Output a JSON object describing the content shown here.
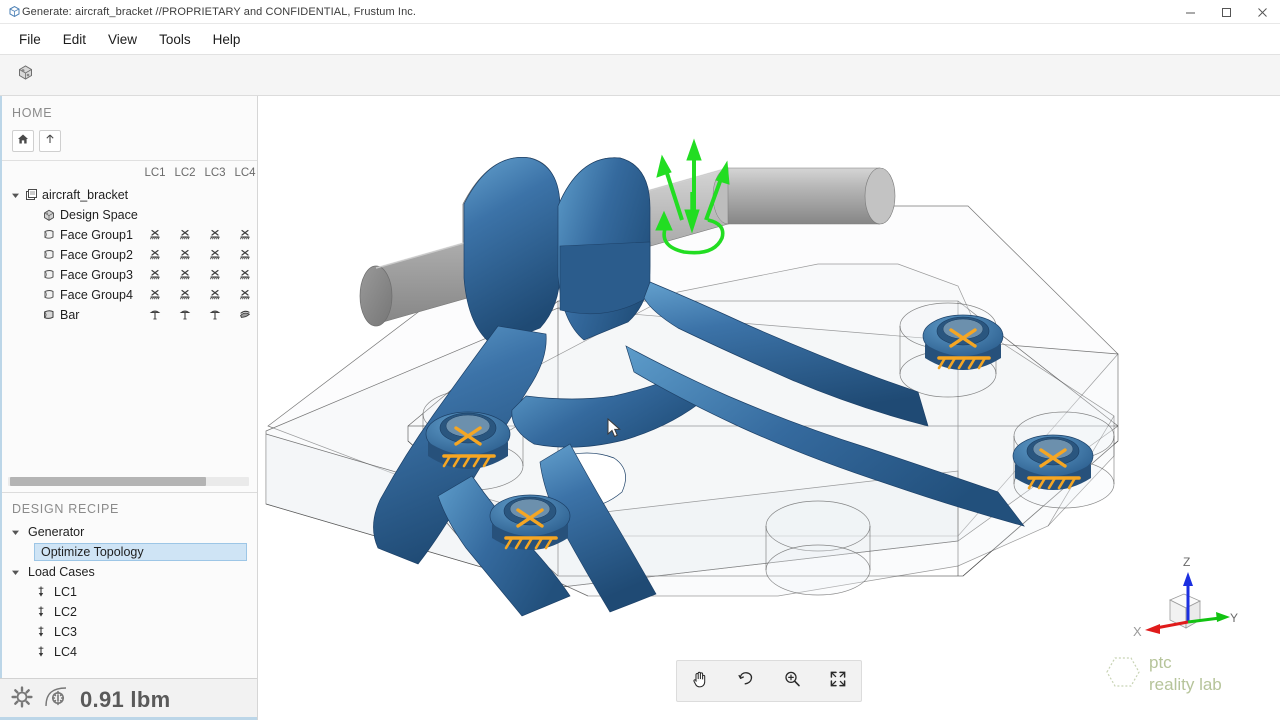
{
  "window": {
    "title": "Generate: aircraft_bracket //PROPRIETARY and CONFIDENTIAL, Frustum Inc.",
    "app_icon": "generate-app-icon",
    "minimize": "–",
    "maximize": "□",
    "close": "×"
  },
  "menubar": {
    "items": [
      {
        "label": "File"
      },
      {
        "label": "Edit"
      },
      {
        "label": "View"
      },
      {
        "label": "Tools"
      },
      {
        "label": "Help"
      }
    ]
  },
  "toolbar": {
    "items": [
      {
        "name": "part-model-icon",
        "tooltip": "Part"
      }
    ]
  },
  "browser": {
    "title": "HOME",
    "nav": [
      {
        "name": "home-button",
        "icon": "home-icon"
      },
      {
        "name": "up-level-button",
        "icon": "arrow-up-icon"
      }
    ],
    "load_case_columns": [
      "LC1",
      "LC2",
      "LC3",
      "LC4"
    ],
    "tree": [
      {
        "label": "aircraft_bracket",
        "icon": "assembly-icon",
        "indent": 0,
        "expander": "expanded",
        "markers": [
          "",
          "",
          "",
          ""
        ]
      },
      {
        "label": "Design Space",
        "icon": "design-space-icon",
        "indent": 1,
        "expander": "none",
        "markers": [
          "",
          "",
          "",
          ""
        ]
      },
      {
        "label": "Face Group1",
        "icon": "face-group-icon",
        "indent": 1,
        "expander": "none",
        "markers": [
          "constraint",
          "constraint",
          "constraint",
          "constraint"
        ]
      },
      {
        "label": "Face Group2",
        "icon": "face-group-icon",
        "indent": 1,
        "expander": "none",
        "markers": [
          "constraint",
          "constraint",
          "constraint",
          "constraint"
        ]
      },
      {
        "label": "Face Group3",
        "icon": "face-group-icon",
        "indent": 1,
        "expander": "none",
        "markers": [
          "constraint",
          "constraint",
          "constraint",
          "constraint"
        ]
      },
      {
        "label": "Face Group4",
        "icon": "face-group-icon",
        "indent": 1,
        "expander": "none",
        "markers": [
          "constraint",
          "constraint",
          "constraint",
          "constraint"
        ]
      },
      {
        "label": "Bar",
        "icon": "bar-body-icon",
        "indent": 1,
        "expander": "none",
        "markers": [
          "load",
          "load",
          "load",
          "moment"
        ]
      }
    ]
  },
  "recipe": {
    "title": "DESIGN RECIPE",
    "groups": [
      {
        "label": "Generator",
        "expander": "expanded",
        "items": [
          {
            "label": "Optimize Topology",
            "selected": true,
            "icon": "none"
          }
        ]
      },
      {
        "label": "Load Cases",
        "expander": "expanded",
        "items": [
          {
            "label": "LC1",
            "selected": false,
            "icon": "load-case-icon"
          },
          {
            "label": "LC2",
            "selected": false,
            "icon": "load-case-icon"
          },
          {
            "label": "LC3",
            "selected": false,
            "icon": "load-case-icon"
          },
          {
            "label": "LC4",
            "selected": false,
            "icon": "load-case-icon"
          }
        ]
      }
    ]
  },
  "status": {
    "icons": [
      {
        "name": "settings-gear-icon"
      },
      {
        "name": "generate-run-icon"
      }
    ],
    "mass_value": "0.91 lbm"
  },
  "viewport": {
    "tools": [
      {
        "name": "pan-tool-button",
        "icon": "hand-icon",
        "active": true
      },
      {
        "name": "rotate-tool-button",
        "icon": "orbit-icon",
        "active": false
      },
      {
        "name": "zoom-tool-button",
        "icon": "magnifier-plus-icon",
        "active": false
      },
      {
        "name": "fit-view-button",
        "icon": "expand-arrows-icon",
        "active": false
      }
    ],
    "axis_triad": {
      "x_label": "X",
      "y_label": "Y",
      "z_label": "Z",
      "x_color": "#e01b1b",
      "y_color": "#12c312",
      "z_color": "#1b2fe0"
    },
    "watermark": {
      "line1": "ptc",
      "line2": "reality lab",
      "color": "#b6c49a"
    },
    "model": {
      "body_color": "#2f6294",
      "bar_color": "#a8a8a8",
      "load_arrow_color": "#22dd22",
      "constraint_color": "#f5a623",
      "design_space_edge_color": "#555555"
    }
  }
}
